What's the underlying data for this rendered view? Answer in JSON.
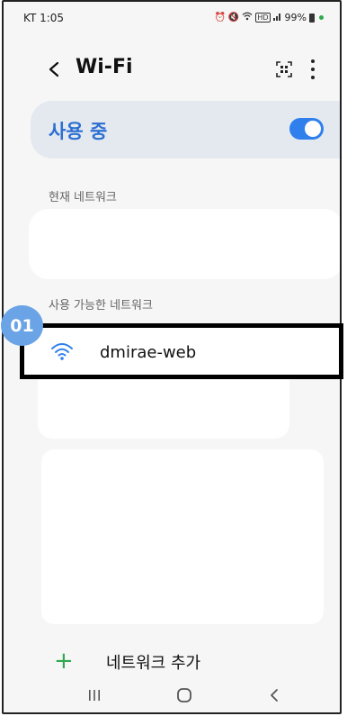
{
  "status_bar": {
    "carrier_time": "KT 1:05",
    "icons": [
      "alarm-icon",
      "mute-icon",
      "wifi-status-icon",
      "hd-icon",
      "signal-icon"
    ],
    "battery": "99%"
  },
  "header": {
    "title": "Wi-Fi",
    "back_icon": "chevron-left-icon",
    "qr_icon": "qr-scan-icon",
    "more_icon": "more-vertical-icon"
  },
  "wifi_toggle": {
    "label": "사용 중",
    "on": true,
    "accent": "#2f80ed"
  },
  "current_network": {
    "header": "현재 네트워크"
  },
  "available_networks": {
    "header": "사용 가능한 네트워크",
    "items": [
      {
        "name": "dmirae-web",
        "icon": "wifi-signal-icon"
      }
    ]
  },
  "annotation_badge": "01",
  "add_network": {
    "label": "네트워크 추가",
    "icon": "plus-icon"
  },
  "nav_bar": {
    "buttons": [
      "recents-icon",
      "home-icon",
      "back-nav-icon"
    ]
  }
}
